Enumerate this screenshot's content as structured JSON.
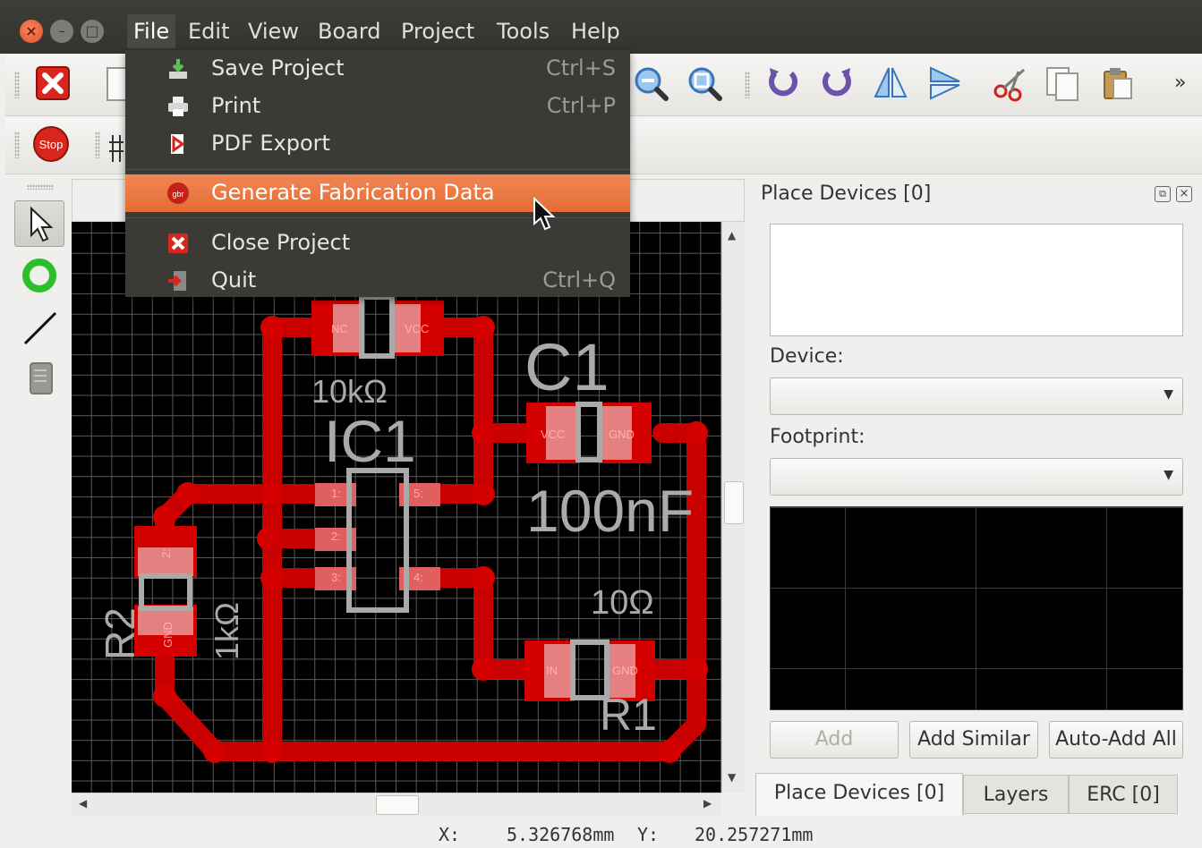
{
  "window": {
    "close_glyph": "×",
    "min_glyph": "–",
    "max_glyph": "□"
  },
  "menubar": [
    {
      "label": "File"
    },
    {
      "label": "Edit"
    },
    {
      "label": "View"
    },
    {
      "label": "Board"
    },
    {
      "label": "Project"
    },
    {
      "label": "Tools"
    },
    {
      "label": "Help"
    }
  ],
  "file_menu": {
    "items": [
      {
        "label": "Save Project",
        "shortcut": "Ctrl+S",
        "icon": "save-icon"
      },
      {
        "label": "Print",
        "shortcut": "Ctrl+P",
        "icon": "printer-icon"
      },
      {
        "label": "PDF Export",
        "shortcut": "",
        "icon": "pdf-icon"
      },
      {
        "label": "Generate Fabrication Data",
        "shortcut": "",
        "icon": "gerber-icon",
        "highlighted": true
      },
      {
        "label": "Close Project",
        "shortcut": "",
        "icon": "close-project-icon"
      },
      {
        "label": "Quit",
        "shortcut": "Ctrl+Q",
        "icon": "quit-icon"
      }
    ],
    "highlight_color": "#e9743d"
  },
  "toolbar": {
    "overflow": "»",
    "stop_label": "Stop"
  },
  "board": {
    "labels": {
      "c1": "C1",
      "c1_value": "100nF",
      "ic1": "IC1",
      "r_top_value": "10kΩ",
      "r1": "R1",
      "r1_value": "10Ω",
      "r2": "R2",
      "r2_value": "1kΩ"
    },
    "pads": {
      "top_left": "NC",
      "top_right": "VCC",
      "c1_left": "VCC",
      "c1_right": "GND",
      "ic_1": "1:",
      "ic_2": "2:",
      "ic_3": "3:",
      "ic_4": "4:",
      "ic_5": "5:",
      "r1_left": "IN",
      "r1_right": "GND",
      "r2_top": "2:",
      "r2_bottom": "GND"
    },
    "trace_color": "#d40000",
    "grid_color": "#5a5a5a"
  },
  "dock": {
    "title": "Place Devices [0]",
    "device_label": "Device:",
    "footprint_label": "Footprint:",
    "buttons": {
      "add": "Add",
      "add_similar": "Add Similar",
      "auto_add_all": "Auto-Add All"
    },
    "tabs": [
      {
        "label": "Place Devices [0]",
        "active": true
      },
      {
        "label": "Layers",
        "active": false
      },
      {
        "label": "ERC [0]",
        "active": false
      }
    ]
  },
  "status": {
    "x_label": "X:",
    "x_value": "5.326768mm",
    "y_label": "Y:",
    "y_value": "20.257271mm"
  }
}
